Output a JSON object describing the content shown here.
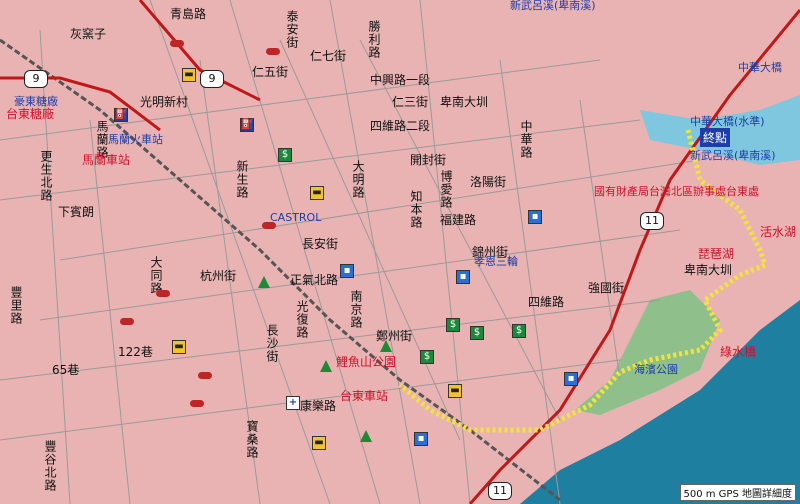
{
  "colors": {
    "land": "#e9b3b3",
    "water": "#1f7fa0",
    "park": "#8fbf8a",
    "route": "#f0e050",
    "highway": "#c01818",
    "railway": "#6a6a6a",
    "road": "#9a9a9a"
  },
  "highway_shields": [
    {
      "label": "9"
    },
    {
      "label": "9"
    },
    {
      "label": "11"
    },
    {
      "label": "11"
    }
  ],
  "labels_dark": [
    "灰窯子",
    "光明新村",
    "下賓朗",
    "仁五街",
    "仁七街",
    "中興路一段",
    "四維路二段",
    "開封街",
    "長安街",
    "正氣北路",
    "博愛路",
    "大同路",
    "65巷",
    "122巷",
    "新生路",
    "康樂路",
    "強國街",
    "四維路",
    "豐里路",
    "勝利路",
    "卑南大圳",
    "卑南大圳",
    "福建路",
    "南京路",
    "杭州街",
    "青島路",
    "泰安街",
    "仁三街",
    "知本路",
    "豐谷北路",
    "更生北路",
    "洛陽街",
    "中華路",
    "光復路",
    "長沙街",
    "馬蘭路",
    "鄭州街",
    "寶桑路",
    "錦州街",
    "大明路"
  ],
  "labels_red": [
    "台東糖廠",
    "馬蘭車站",
    "台東車站",
    "琵琶湖",
    "活水湖",
    "綠水橋",
    "鯉魚山公園",
    "國有財產局台灣北區辦事處台東處"
  ],
  "labels_blue": [
    "豪東糖廠",
    "馬蘭火車站",
    "新武呂溪(卑南溪)",
    "中華大橋",
    "中華大橋(水準)",
    "新武呂溪(卑南溪)",
    "CASTROL",
    "孝恩三輪",
    "海濱公園"
  ],
  "end_marker": "終點",
  "scale_text": "500 m  GPS 地圖詳細度",
  "poi_glyphs": {
    "bank": "$",
    "food": "▬",
    "building": "▪",
    "hospital": "+",
    "gas": "⛽"
  }
}
